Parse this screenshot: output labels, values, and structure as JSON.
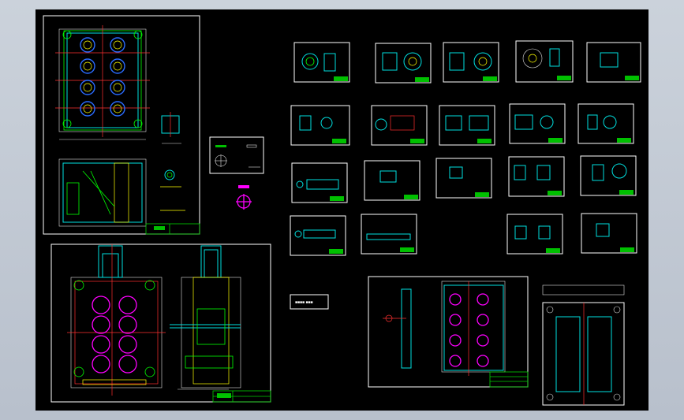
{
  "window": {
    "background_color": "#c4cbd5",
    "canvas_color": "#000000"
  },
  "colors": {
    "frame": "#ffffff",
    "title_block": "#00c000",
    "outline": "#00e0e0",
    "center_line": "#ff3030",
    "hatch": "#ffff00",
    "cavity": "#ff00ff",
    "bore": "#2a6bff"
  },
  "sheets": {
    "cavity_plate_plan": "cavity-plate-plan",
    "mold_assembly": "mold-assembly",
    "parts_grid": "parts-detail-grid",
    "plate_detail": "plate-detail",
    "insert_plate": "insert-plate"
  },
  "notes": {
    "center_text": "■■■■ ■■■"
  }
}
